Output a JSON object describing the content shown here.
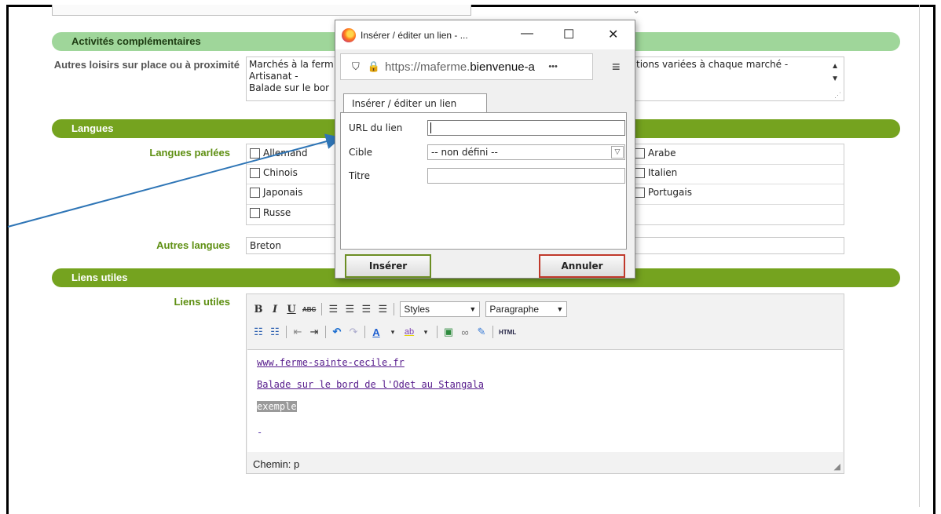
{
  "sections": {
    "activites": "Activités complémentaires",
    "langues": "Langues",
    "liens": "Liens utiles"
  },
  "activites": {
    "label": "Autres loisirs sur place ou à proximité",
    "text_left": "Marchés à la ferm\nArtisanat -\nBalade sur le bor",
    "text_right": "tions variées à chaque marché -"
  },
  "langues": {
    "label": "Langues parlées",
    "items": [
      "Allemand",
      "Arabe",
      "Chinois",
      "Italien",
      "Japonais",
      "Portugais",
      "Russe"
    ],
    "autres_label": "Autres langues",
    "autres_value": "Breton"
  },
  "liens": {
    "label": "Liens utiles",
    "styles_select": "Styles",
    "format_select": "Paragraphe",
    "html_btn": "HTML",
    "content": [
      "www.ferme-sainte-cecile.fr",
      "Balade sur le bord de l'Odet au Stangala",
      "exemple",
      "-"
    ],
    "path": "Chemin: p"
  },
  "dialog": {
    "window_title": "Insérer / éditer un lien - ...",
    "url_prefix": "https://maferme.",
    "url_domain": "bienvenue-a",
    "url_more": "•••",
    "tab_label": "Insérer / éditer un lien",
    "url_label": "URL du lien",
    "url_value": "",
    "target_label": "Cible",
    "target_value": "-- non défini --",
    "title_label": "Titre",
    "title_value": "",
    "insert_label": "Insérer",
    "cancel_label": "Annuler"
  },
  "colors": {
    "bar_light": "#9fd69a",
    "bar_dark": "#75a31f",
    "label_green": "#5e8f12",
    "cancel_border": "#c0392b",
    "insert_border": "#6b8e23",
    "arrow": "#2e75b6"
  }
}
